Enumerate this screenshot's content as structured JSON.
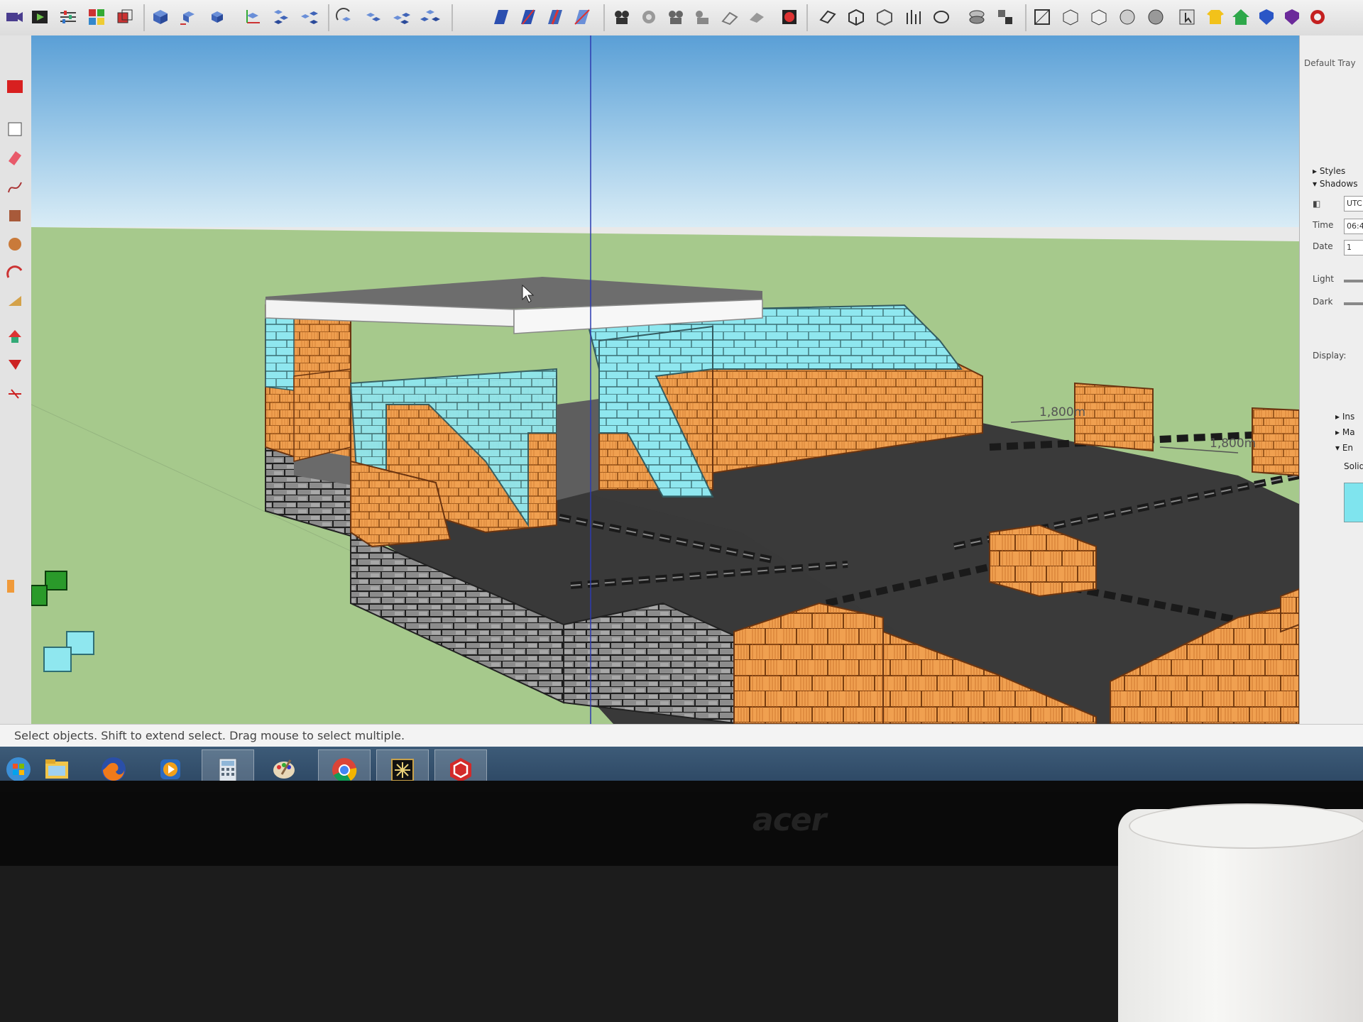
{
  "tray": {
    "title": "Default Tray",
    "styles": "Styles",
    "shadows": "Shadows",
    "utc": "UTC",
    "time_label": "Time",
    "time_value": "06:4",
    "date_label": "Date",
    "date_value": "1",
    "light_label": "Light",
    "dark_label": "Dark",
    "display_label": "Display:",
    "collapsed_items": [
      "Ins",
      "Ma",
      "En"
    ],
    "solid_label": "Solid"
  },
  "viewport": {
    "dimension_1": "1,800m",
    "dimension_2": "1,800m"
  },
  "status": {
    "message": "Select objects. Shift to extend select. Drag mouse to select multiple."
  },
  "taskbar": {
    "apps": [
      "windows-start",
      "file-explorer",
      "firefox",
      "media-player",
      "calculator",
      "paint",
      "chrome",
      "archive-app",
      "sketchup"
    ]
  },
  "monitor": {
    "brand": "acer"
  },
  "colors": {
    "sky_top": "#5a9fd6",
    "sky_horizon": "#d9ecf6",
    "ground": "#a6c98c",
    "brick_orange": "#f0a050",
    "brick_cyan": "#8fe7ef",
    "concrete_gray": "#8c8c8c",
    "floor_slab": "#3a3a3a"
  }
}
